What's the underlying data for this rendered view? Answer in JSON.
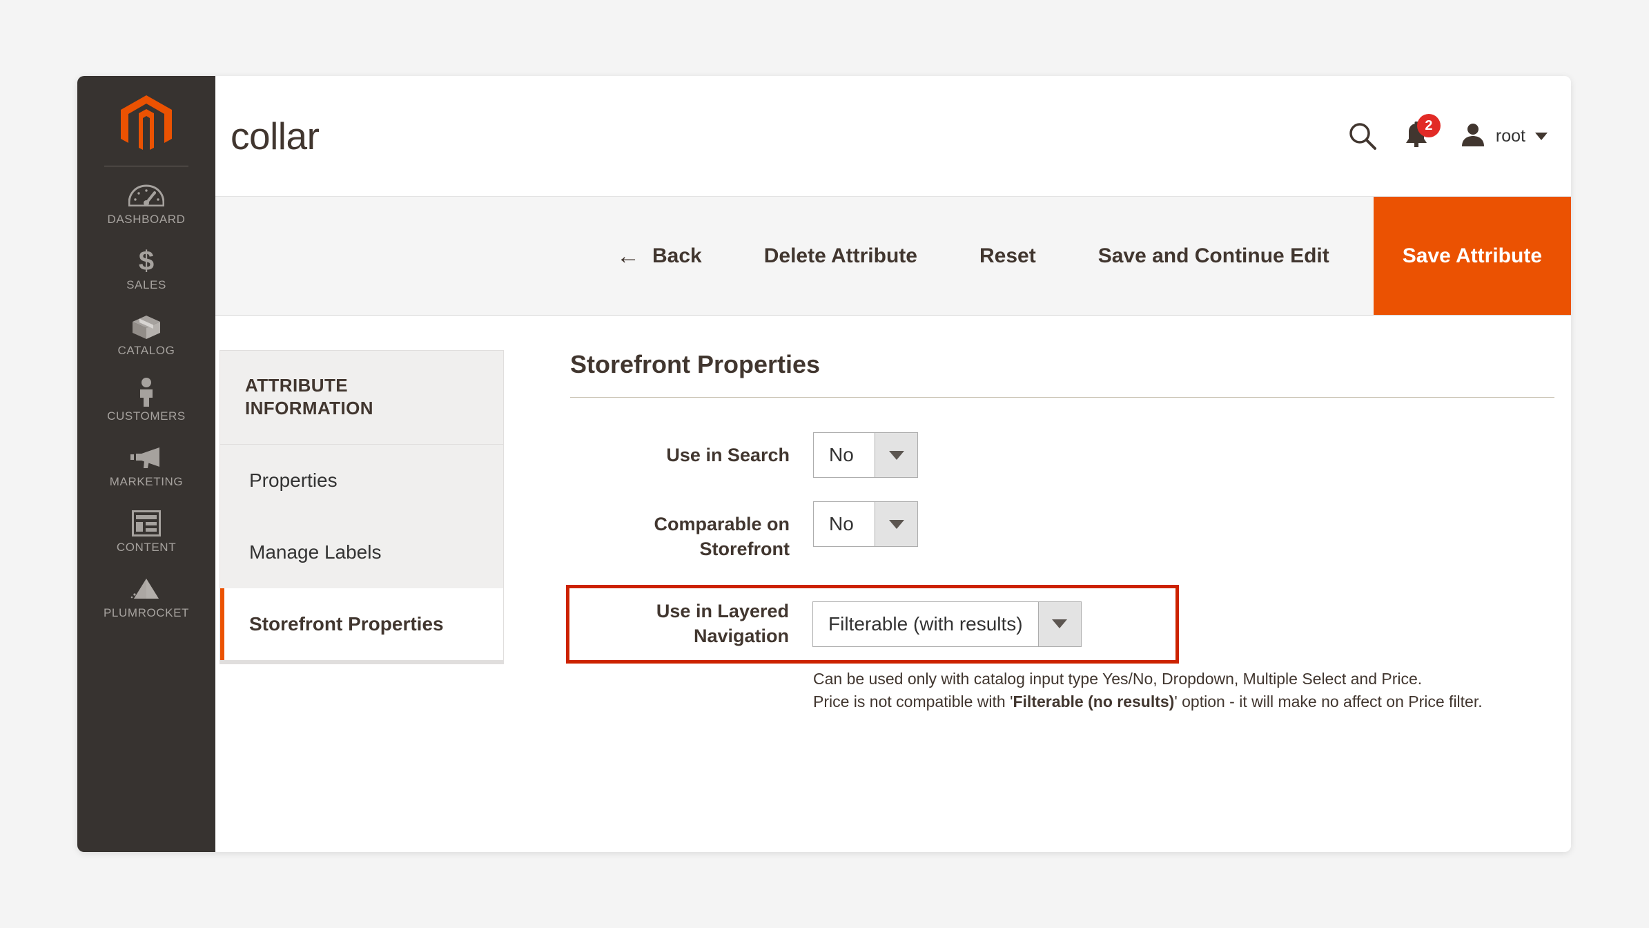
{
  "header": {
    "page_title": "collar",
    "search_icon": "search-icon",
    "notifications": {
      "icon": "bell-icon",
      "count": "2",
      "badge_color": "#e22b26"
    },
    "user": {
      "avatar_icon": "user-avatar-icon",
      "name": "root",
      "caret": "chevron-down-icon"
    }
  },
  "sidebar": {
    "logo": "magento-logo-icon",
    "items": [
      {
        "label": "DASHBOARD",
        "icon": "dashboard-gauge-icon"
      },
      {
        "label": "SALES",
        "icon": "dollar-sign-icon"
      },
      {
        "label": "CATALOG",
        "icon": "box-icon"
      },
      {
        "label": "CUSTOMERS",
        "icon": "person-icon"
      },
      {
        "label": "MARKETING",
        "icon": "megaphone-icon"
      },
      {
        "label": "CONTENT",
        "icon": "layout-grid-icon"
      },
      {
        "label": "PLUMROCKET",
        "icon": "plumrocket-pyramid-icon"
      }
    ]
  },
  "toolbar": {
    "back_arrow": "←",
    "back": "Back",
    "delete_attribute": "Delete Attribute",
    "reset": "Reset",
    "save_and_continue": "Save and Continue Edit",
    "save_attribute": "Save Attribute",
    "primary_color": "#eb5202"
  },
  "attribute_nav": {
    "title": "ATTRIBUTE INFORMATION",
    "items": [
      {
        "label": "Properties",
        "active": false
      },
      {
        "label": "Manage Labels",
        "active": false
      },
      {
        "label": "Storefront Properties",
        "active": true
      }
    ],
    "active_marker_color": "#eb5202"
  },
  "form": {
    "section_title": "Storefront Properties",
    "fields": [
      {
        "label": "Use in Search",
        "value": "No"
      },
      {
        "label": "Comparable on Storefront",
        "value": "No"
      },
      {
        "label": "Use in Layered Navigation",
        "value": "Filterable (with results)"
      }
    ],
    "highlight_color": "#cc2200",
    "help": {
      "line1": "Can be used only with catalog input type Yes/No, Dropdown, Multiple Select and Price.",
      "line2_pre": "Price is not compatible with '",
      "line2_bold": "Filterable (no results)",
      "line2_post": "' option - it will make no affect on Price filter."
    }
  }
}
